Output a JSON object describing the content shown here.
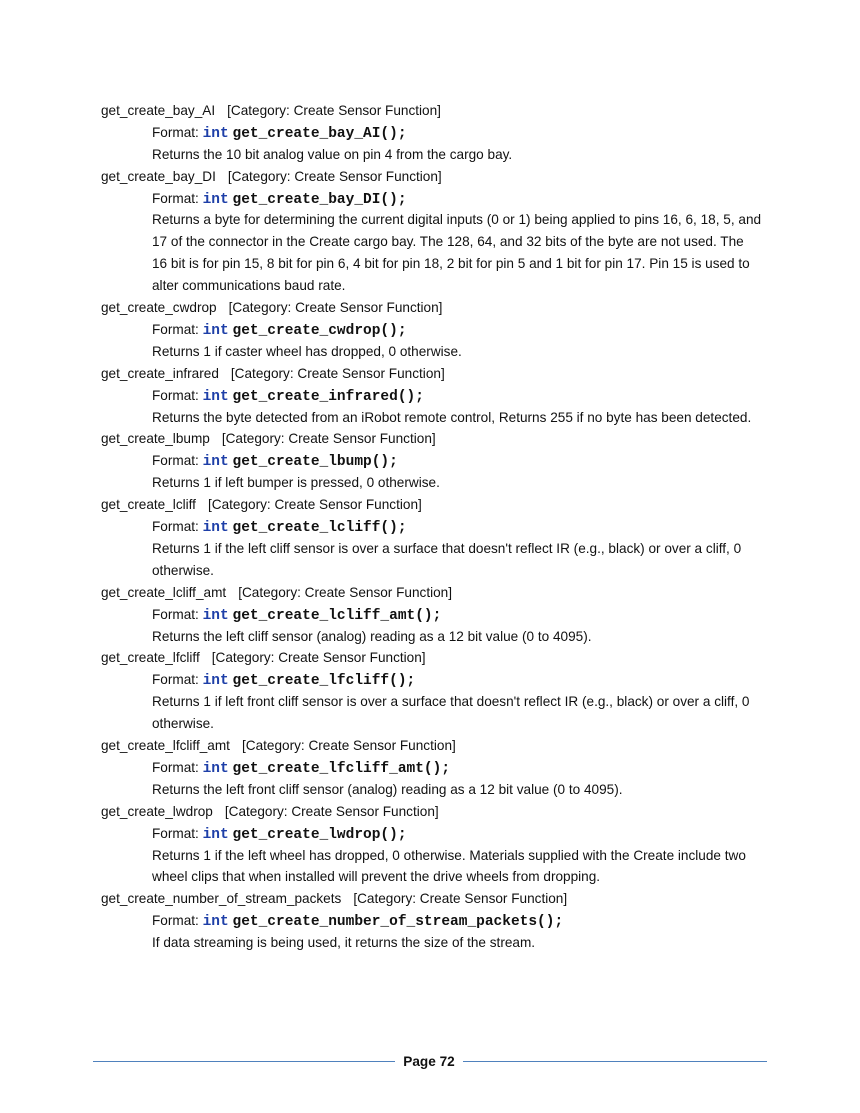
{
  "format_label": "Format:",
  "return_type": "int",
  "entries": [
    {
      "name": "get_create_bay_AI",
      "category": "[Category: Create Sensor Function]",
      "signature": "get_create_bay_AI();",
      "description": "Returns the 10 bit analog value on pin 4 from the cargo bay."
    },
    {
      "name": "get_create_bay_DI",
      "category": "[Category: Create Sensor Function]",
      "signature": "get_create_bay_DI();",
      "description": "Returns a byte for determining the current digital inputs (0 or 1) being applied to pins 16, 6, 18, 5, and 17 of the connector in the Create cargo bay. The 128, 64, and 32 bits of the byte are not used. The 16 bit is for pin 15, 8 bit for pin 6, 4 bit for pin 18, 2 bit for pin 5 and 1 bit for pin 17. Pin 15 is used to alter communications baud rate."
    },
    {
      "name": "get_create_cwdrop",
      "category": "[Category: Create Sensor Function]",
      "signature": "get_create_cwdrop();",
      "description": "Returns 1 if caster wheel has dropped, 0 otherwise."
    },
    {
      "name": "get_create_infrared",
      "category": "[Category: Create Sensor Function]",
      "signature": "get_create_infrared();",
      "description": "Returns the byte detected from an iRobot remote control, Returns 255 if no byte has been detected."
    },
    {
      "name": "get_create_lbump",
      "category": "[Category: Create Sensor Function]",
      "signature": "get_create_lbump();",
      "description": "Returns 1 if left bumper is pressed, 0 otherwise."
    },
    {
      "name": "get_create_lcliff",
      "category": "[Category: Create Sensor Function]",
      "signature": "get_create_lcliff();",
      "description": "Returns 1 if the left cliff sensor is over a surface that doesn't reflect IR (e.g., black) or over a cliff, 0 otherwise."
    },
    {
      "name": "get_create_lcliff_amt",
      "category": "[Category: Create Sensor Function]",
      "signature": "get_create_lcliff_amt();",
      "description": "Returns the left cliff sensor (analog) reading as a 12 bit value (0 to 4095)."
    },
    {
      "name": "get_create_lfcliff",
      "category": "[Category: Create Sensor Function]",
      "signature": "get_create_lfcliff();",
      "description": "Returns 1 if left front cliff sensor is over a surface that doesn't reflect IR (e.g., black) or over a cliff, 0 otherwise."
    },
    {
      "name": "get_create_lfcliff_amt",
      "category": "[Category: Create Sensor Function]",
      "signature": "get_create_lfcliff_amt();",
      "description": "Returns the left front cliff sensor (analog) reading as a 12 bit value (0 to 4095)."
    },
    {
      "name": "get_create_lwdrop",
      "category": "[Category: Create Sensor Function]",
      "signature": "get_create_lwdrop();",
      "description": "Returns 1 if the left wheel has dropped, 0 otherwise. Materials supplied with the Create include two wheel clips that when installed will prevent the drive wheels from dropping."
    },
    {
      "name": "get_create_number_of_stream_packets",
      "category": "[Category: Create Sensor Function]",
      "signature": "get_create_number_of_stream_packets();",
      "description": "If data streaming is being used, it returns the size of the stream."
    }
  ],
  "footer": {
    "page_label": "Page 72"
  }
}
